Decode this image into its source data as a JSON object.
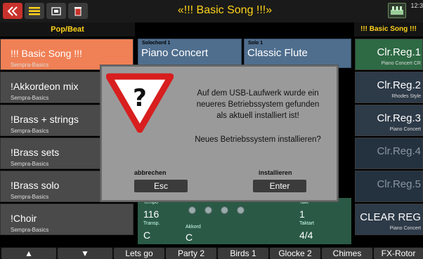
{
  "title": "«!!! Basic Song !!!»",
  "clock": "12:3",
  "subheader_left": "Pop/Beat",
  "subheader_right": "!!! Basic Song !!!",
  "styles": [
    {
      "name": "!!! Basic Song !!!",
      "sub": "Sempra-Basics"
    },
    {
      "name": "!Akkordeon mix",
      "sub": "Sempra-Basics"
    },
    {
      "name": "!Brass + strings",
      "sub": "Sempra-Basics"
    },
    {
      "name": "!Brass sets",
      "sub": "Sempra-Basics"
    },
    {
      "name": "!Brass solo",
      "sub": "Sempra-Basics"
    },
    {
      "name": "!Choir",
      "sub": "Sempra-Basics"
    }
  ],
  "voices": {
    "solochord": {
      "label": "Solochord 1",
      "value": "Piano Concert"
    },
    "solo": {
      "label": "Solo 1",
      "value": "Classic Flute"
    }
  },
  "status": {
    "tempo_label": "Tempo",
    "tempo": "116",
    "transp_label": "Transp.",
    "transp": "C",
    "akkord_label": "Akkord",
    "akkord": "C",
    "takt_label": "Takt",
    "takt": "1",
    "taktart_label": "Taktart",
    "taktart": "4/4"
  },
  "registrations": [
    {
      "label": "Clr.Reg.1",
      "sub": "Piano Concert CR"
    },
    {
      "label": "Clr.Reg.2",
      "sub": "Rhodes Style"
    },
    {
      "label": "Clr.Reg.3",
      "sub": "Piano Concert"
    },
    {
      "label": "Clr.Reg.4",
      "sub": ""
    },
    {
      "label": "Clr.Reg.5",
      "sub": ""
    },
    {
      "label": "CLEAR REG",
      "sub": "Piano Concert"
    }
  ],
  "dialog": {
    "message_line1": "Auf dem USB-Laufwerk wurde ein",
    "message_line2": "neueres Betriebssystem gefunden",
    "message_line3": "als aktuell installiert ist!",
    "question": "Neues Betriebssystem installieren?",
    "cancel_caption": "abbrechen",
    "cancel_button": "Esc",
    "confirm_caption": "installieren",
    "confirm_button": "Enter",
    "warning_symbol": "?"
  },
  "tabs": [
    "▲",
    "▼",
    "Lets go",
    "Party 2",
    "Birds 1",
    "Glocke 2",
    "Chimes",
    "FX-Rotor"
  ],
  "icons": {
    "back": "double-chevron-left-icon",
    "menu": "menu-icon",
    "usb": "usb-icon",
    "trash": "trash-icon",
    "register": "register-icon"
  },
  "colors": {
    "accent_yellow": "#ffd21a",
    "selected_style": "#f08055",
    "back_button": "#c8322c",
    "dialog_bg": "#9a9a9a",
    "warning_red": "#d81e1e"
  }
}
